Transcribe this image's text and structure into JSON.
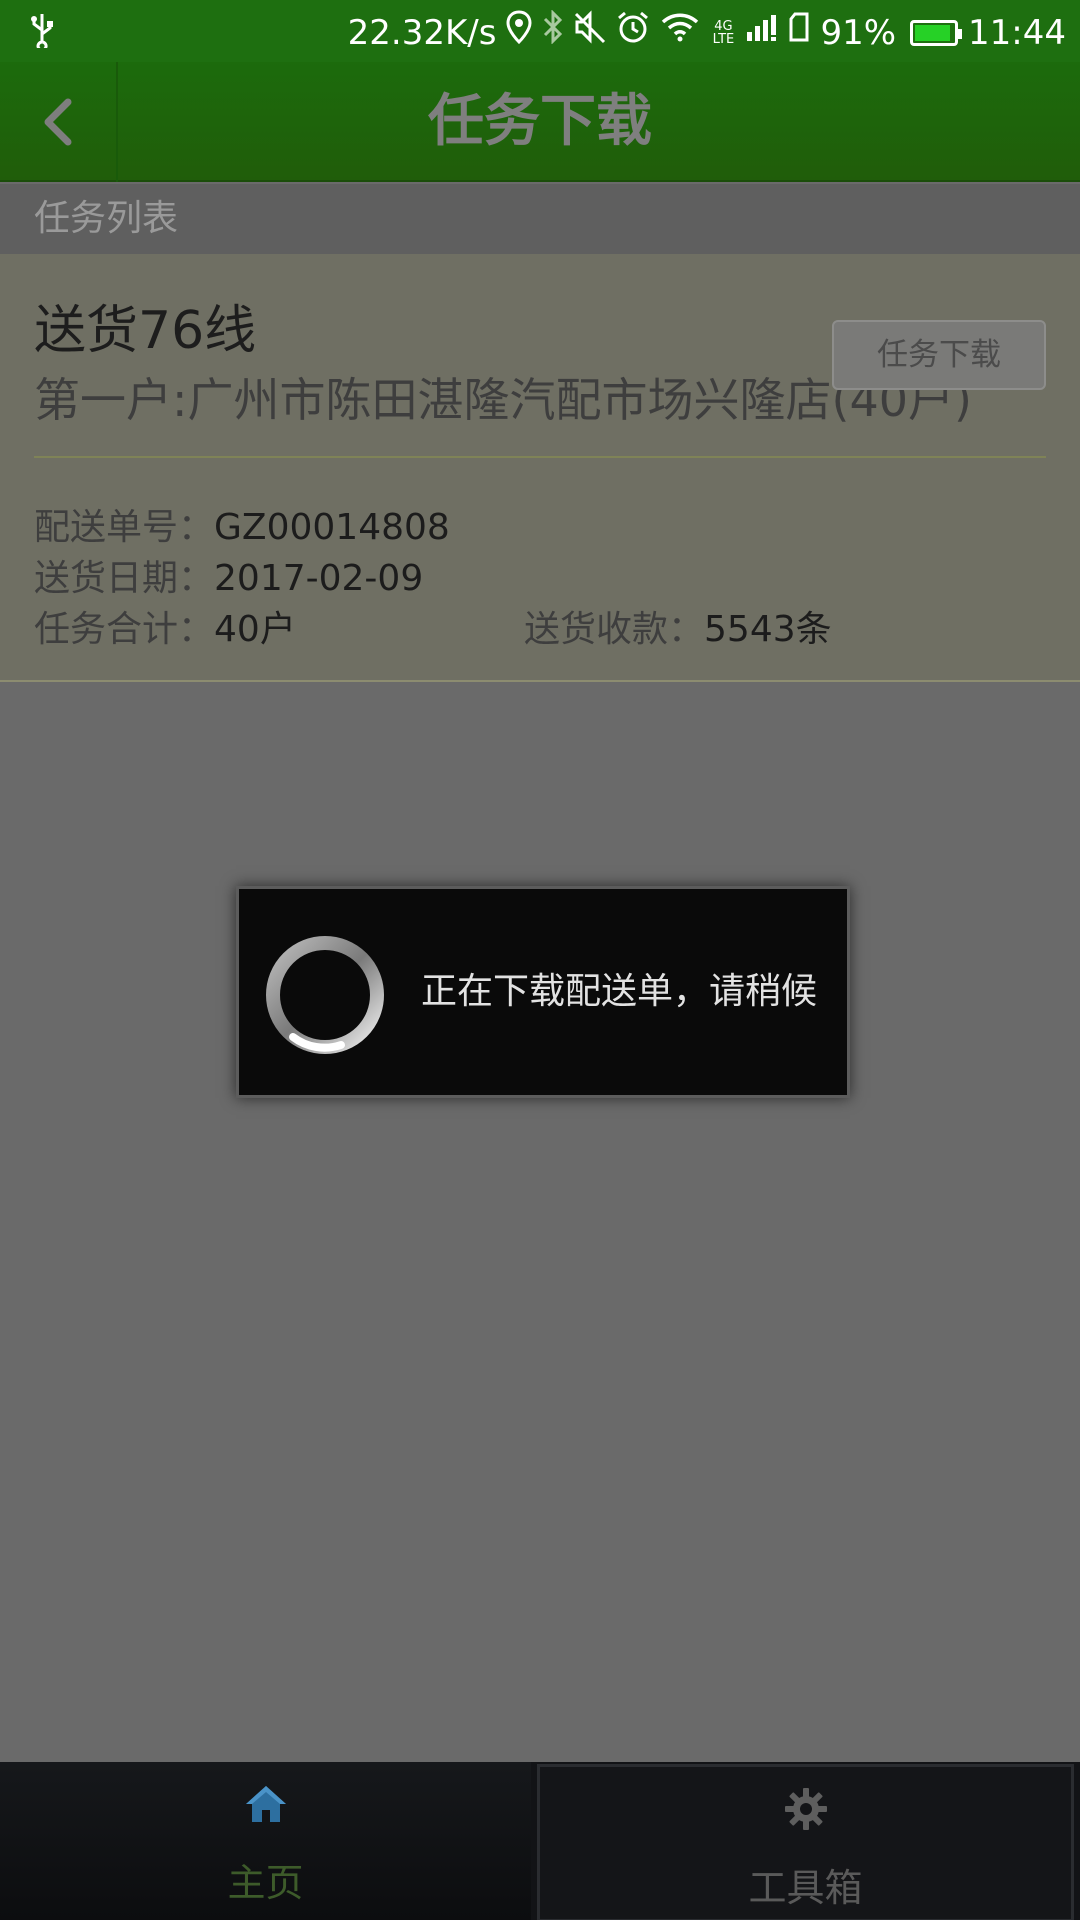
{
  "status_bar": {
    "speed": "22.32K/s",
    "network": "4G LTE",
    "battery": "91%",
    "battery_level": 0.91,
    "time": "11:44",
    "icons": [
      "usb-icon",
      "location-icon",
      "bluetooth-icon",
      "mute-icon",
      "alarm-icon",
      "wifi-icon",
      "signal-icon",
      "sim-icon",
      "battery-icon"
    ]
  },
  "title_bar": {
    "title": "任务下载",
    "back_icon": "chevron-left-icon"
  },
  "section_header": "任务列表",
  "task": {
    "title": "送货76线",
    "first_customer": "第一户:广州市陈田湛隆汽配市场兴隆店(40户)",
    "download_button": "任务下载",
    "order_no_label": "配送单号：",
    "order_no": "GZ00014808",
    "date_label": "送货日期：",
    "date": "2017-02-09",
    "total_label": "任务合计：",
    "total": "40户",
    "payment_label": "送货收款：",
    "payment": "5543条"
  },
  "dialog": {
    "message": "正在下载配送单，请稍候",
    "spinner_icon": "loading-spinner-icon"
  },
  "bottom_nav": {
    "items": [
      {
        "label": "主页",
        "icon": "home-icon",
        "active": true
      },
      {
        "label": "工具箱",
        "icon": "gear-icon",
        "active": false
      }
    ]
  },
  "colors": {
    "header_green": "#1e6f10",
    "overlay_gray": "#6a6a6a",
    "dialog_bg": "#0a0a0a",
    "home_icon_blue": "#2d6fa0"
  }
}
